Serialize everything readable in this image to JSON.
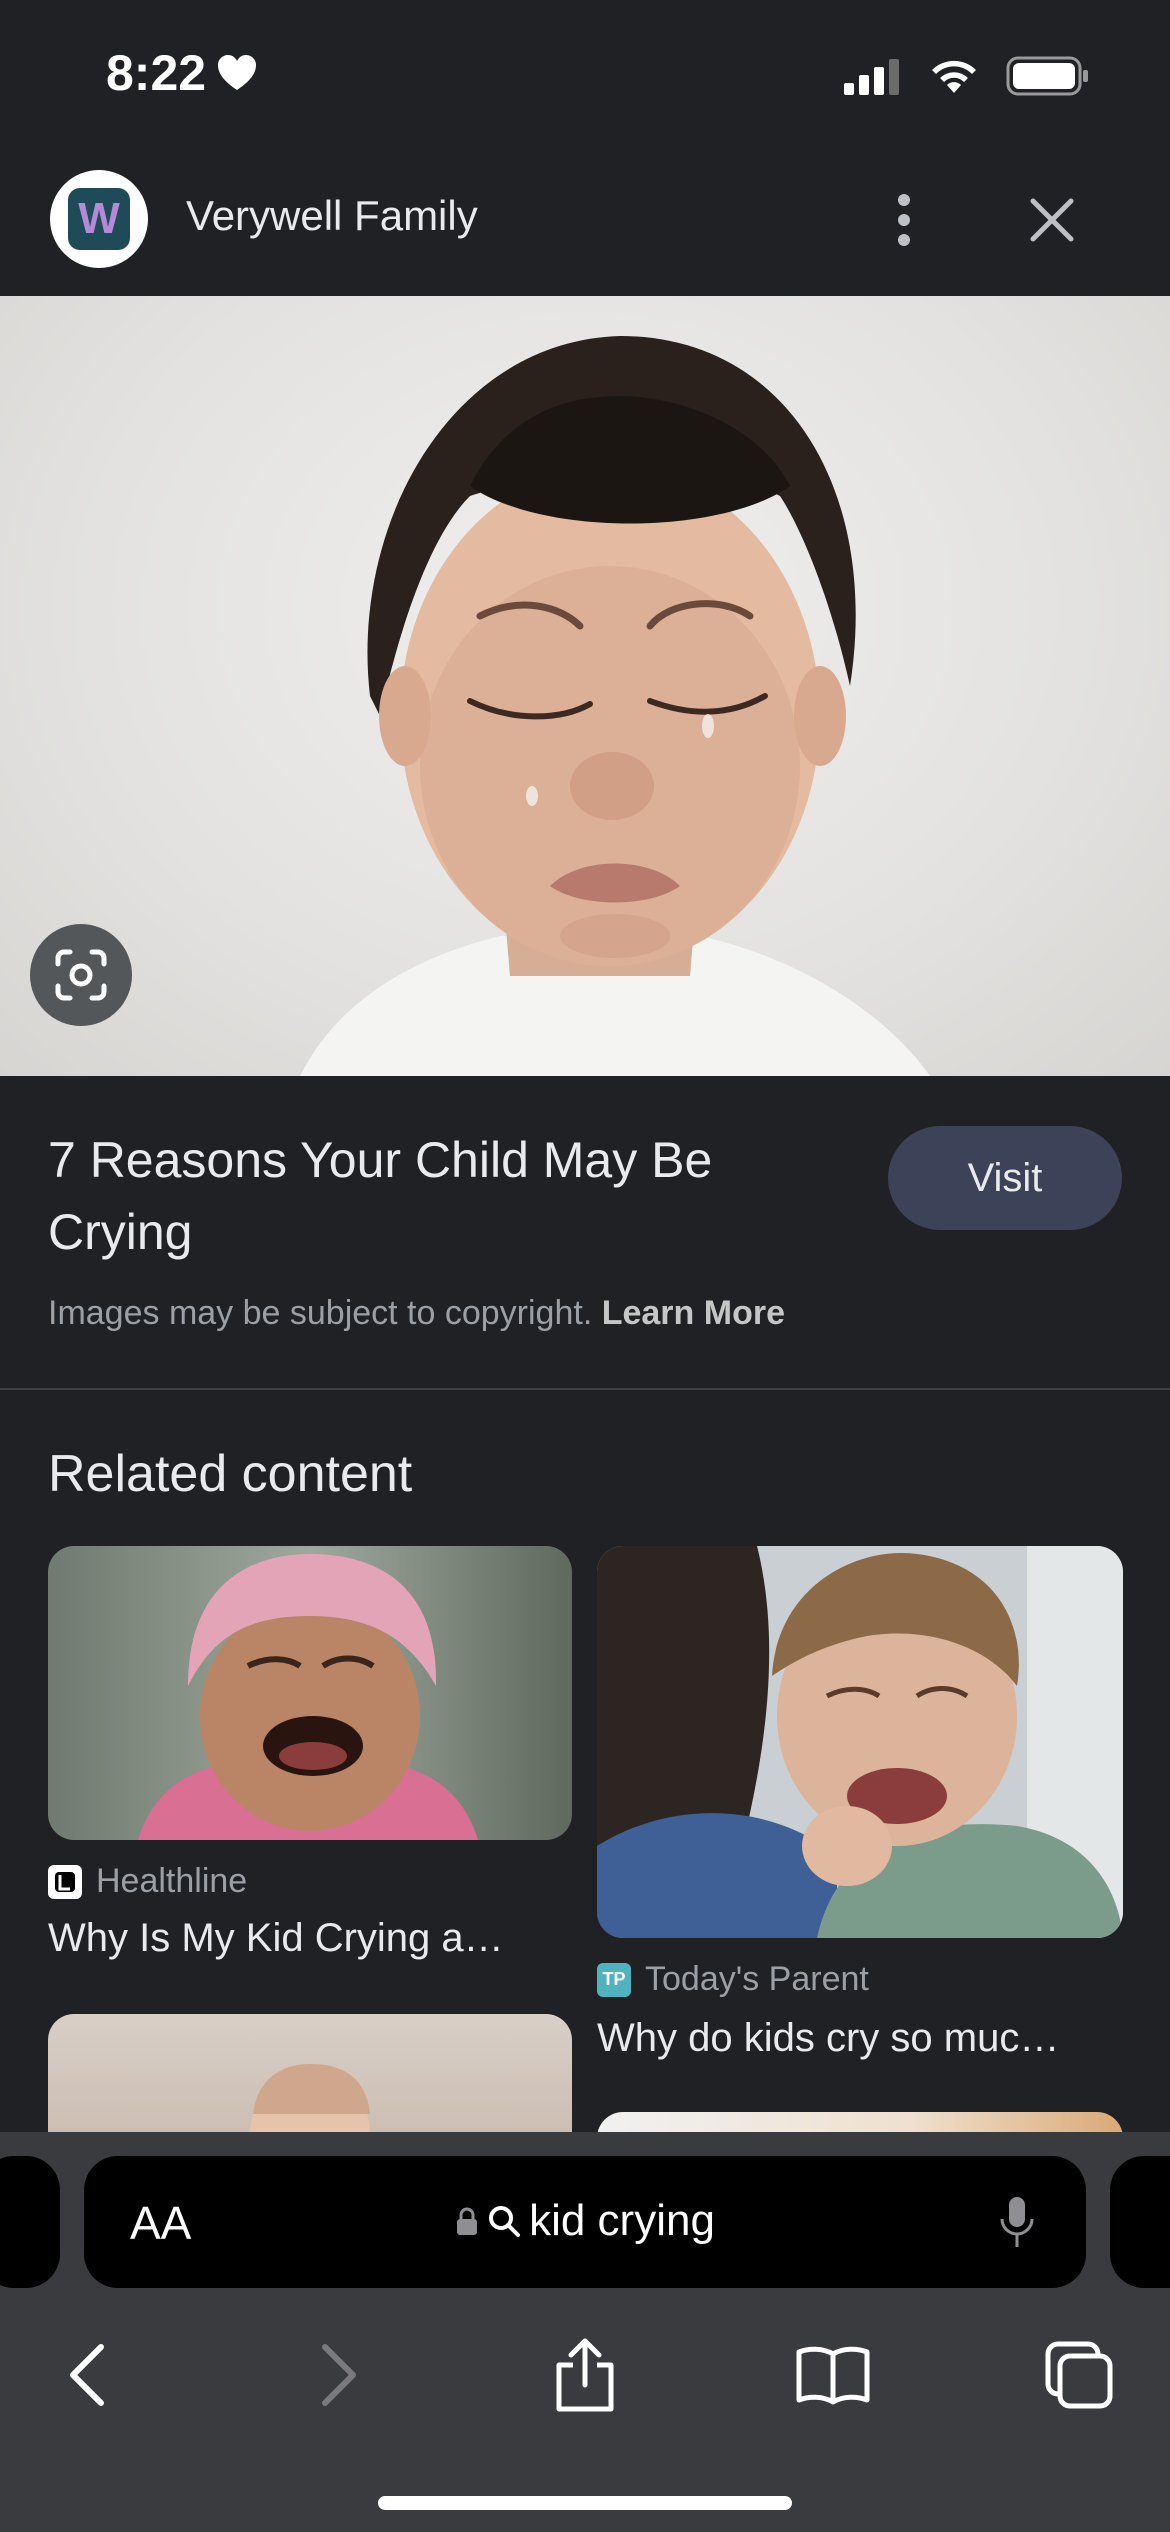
{
  "status_bar": {
    "time": "8:22"
  },
  "header": {
    "site_name": "Verywell Family",
    "logo_letter": "W"
  },
  "result": {
    "title": "7 Reasons Your Child May Be Crying",
    "visit_label": "Visit",
    "copyright_text": "Images may be subject to copyright.",
    "learn_more": "Learn More"
  },
  "related": {
    "heading": "Related content",
    "cards": [
      {
        "source": "Healthline",
        "title": "Why Is My Kid Crying a…"
      },
      {
        "source": "Today's Parent",
        "source_icon_text": "TP",
        "title": "Why do kids cry so muc…"
      }
    ]
  },
  "browser": {
    "aa_label": "AA",
    "url_text": "kid crying"
  },
  "colors": {
    "background": "#202124",
    "visit_button": "#3c4257",
    "toolbar": "#3a3b3e",
    "todays_parent_icon": "#4fb3bf"
  }
}
